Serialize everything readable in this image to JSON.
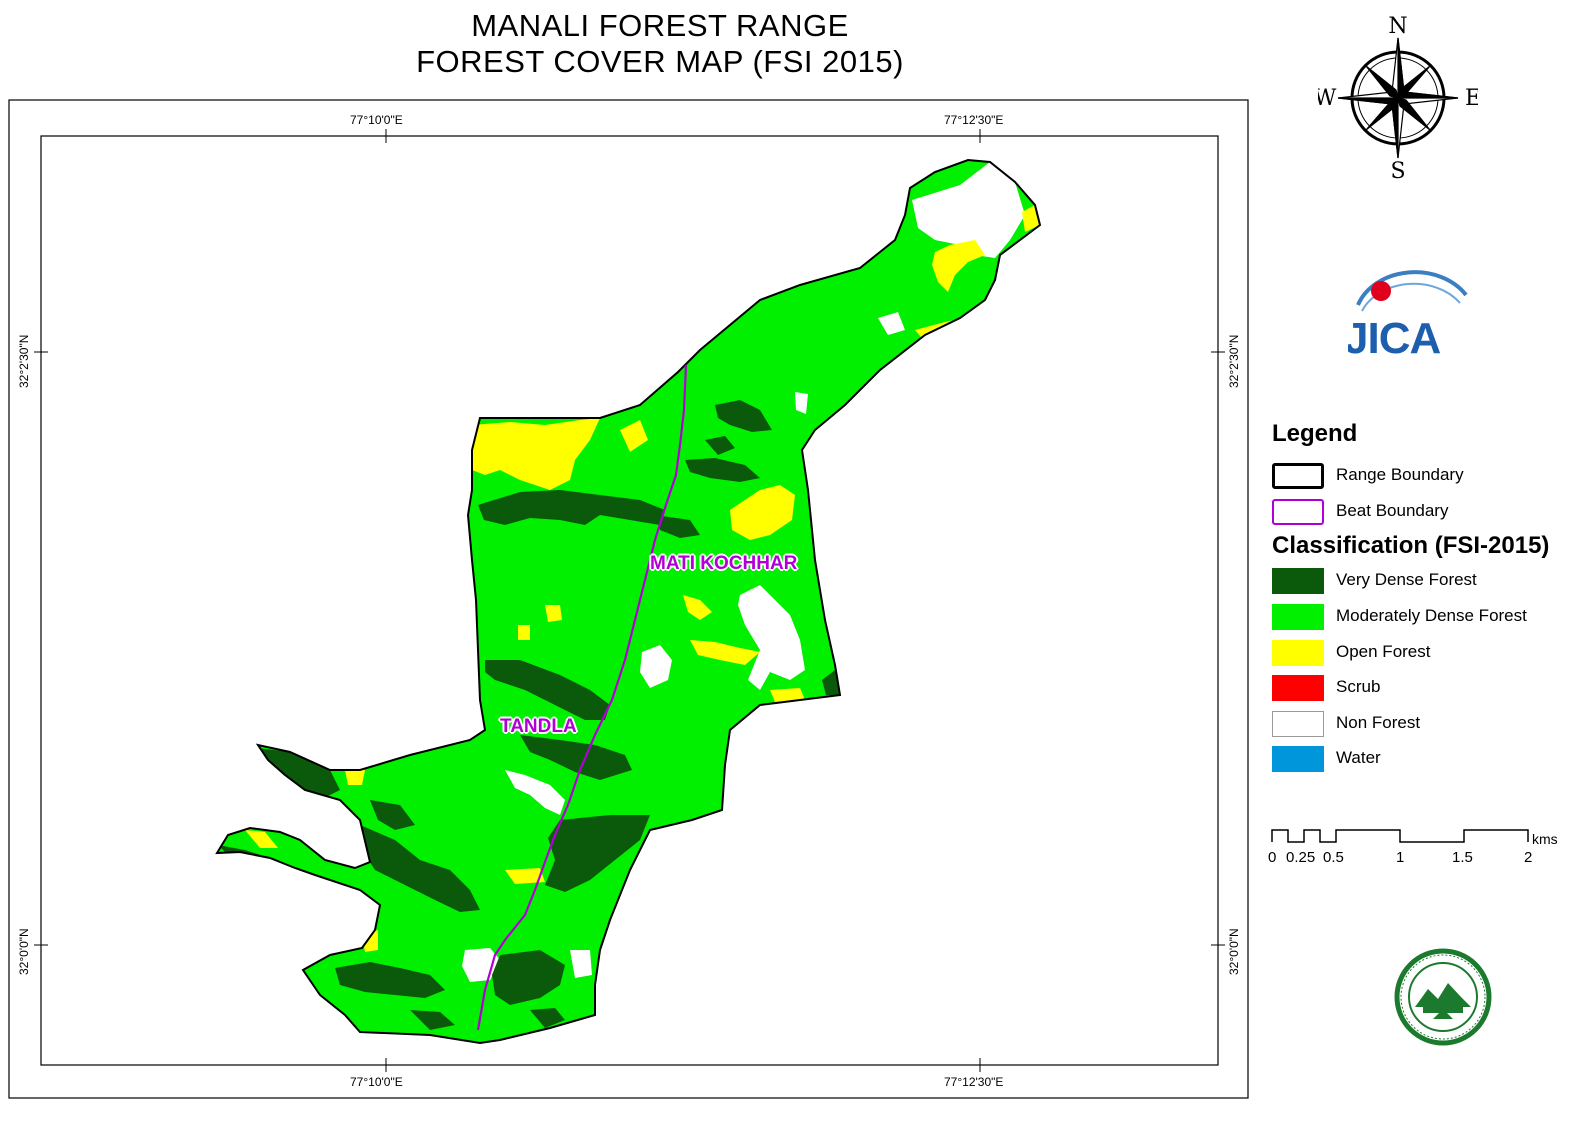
{
  "title": {
    "line1": "MANALI FOREST RANGE",
    "line2": "FOREST COVER MAP (FSI 2015)"
  },
  "compass": {
    "n": "N",
    "s": "S",
    "e": "E",
    "w": "W"
  },
  "logo": {
    "text": "JICA"
  },
  "coordinates": {
    "top_left": "77°10'0\"E",
    "top_right": "77°12'30\"E",
    "bottom_left": "77°10'0\"E",
    "bottom_right": "77°12'30\"E",
    "left_upper": "32°2'30\"N",
    "left_lower": "32°0'0\"N",
    "right_upper": "32°2'30\"N",
    "right_lower": "32°0'0\"N"
  },
  "beats": [
    {
      "name": "MATI KOCHHAR"
    },
    {
      "name": "TANDLA"
    }
  ],
  "legend": {
    "title": "Legend",
    "range_boundary": "Range Boundary",
    "beat_boundary": "Beat Boundary",
    "classification_title": "Classification (FSI-2015)",
    "classes": [
      {
        "label": "Very Dense Forest",
        "color": "#0b5a0b"
      },
      {
        "label": "Moderately Dense Forest",
        "color": "#00f000"
      },
      {
        "label": "Open Forest",
        "color": "#ffff00"
      },
      {
        "label": "Scrub",
        "color": "#ff0000"
      },
      {
        "label": "Non Forest",
        "color": "#ffffff"
      },
      {
        "label": "Water",
        "color": "#0096dc"
      }
    ],
    "range_color": "#000000",
    "beat_color": "#b100d6"
  },
  "scale": {
    "ticks": [
      "0",
      "0.25",
      "0.5",
      "1",
      "1.5",
      "2"
    ],
    "unit": "kms"
  }
}
